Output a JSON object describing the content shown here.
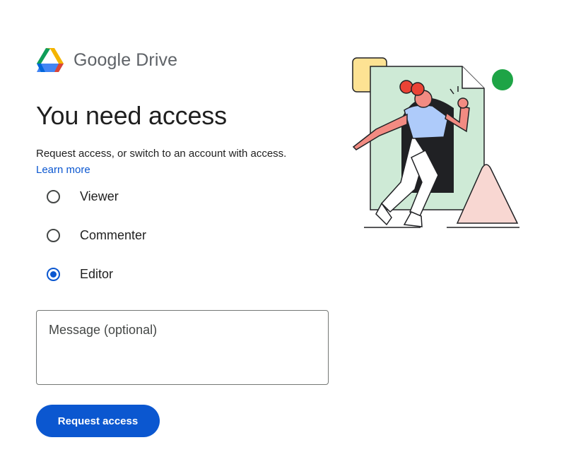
{
  "header": {
    "brand_google": "Google",
    "brand_product": "Drive"
  },
  "main": {
    "title": "You need access",
    "subtitle": "Request access, or switch to an account with access.",
    "learn_more": "Learn more",
    "roles": [
      {
        "label": "Viewer",
        "selected": false
      },
      {
        "label": "Commenter",
        "selected": false
      },
      {
        "label": "Editor",
        "selected": true
      }
    ],
    "message_placeholder": "Message (optional)",
    "request_button": "Request access"
  },
  "colors": {
    "accent": "#0b57d0",
    "drive_green": "#0f9d58",
    "drive_blue": "#4285f4",
    "drive_yellow": "#f4b400",
    "drive_red": "#db4437"
  }
}
